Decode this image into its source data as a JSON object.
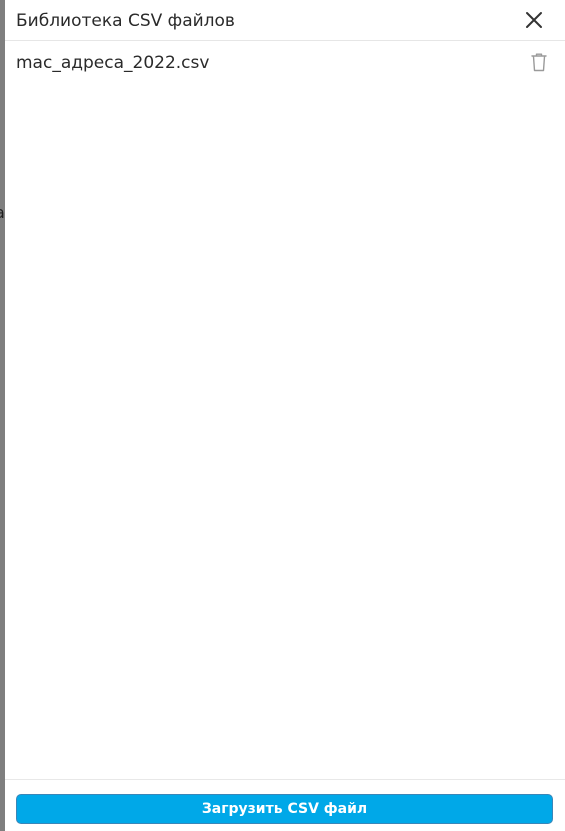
{
  "backdrop": {
    "peek_text": "a"
  },
  "dialog": {
    "title": "Библиотека CSV файлов",
    "close_icon": "close-icon",
    "files": [
      {
        "name": "mac_адреса_2022.csv",
        "action_icon": "trash-icon"
      }
    ],
    "upload_label": "Загрузить CSV файл"
  },
  "colors": {
    "accent": "#00a8e8",
    "text": "#2a2a2a",
    "icon_gray": "#9a9a9a",
    "backdrop": "#7f7f7f"
  }
}
